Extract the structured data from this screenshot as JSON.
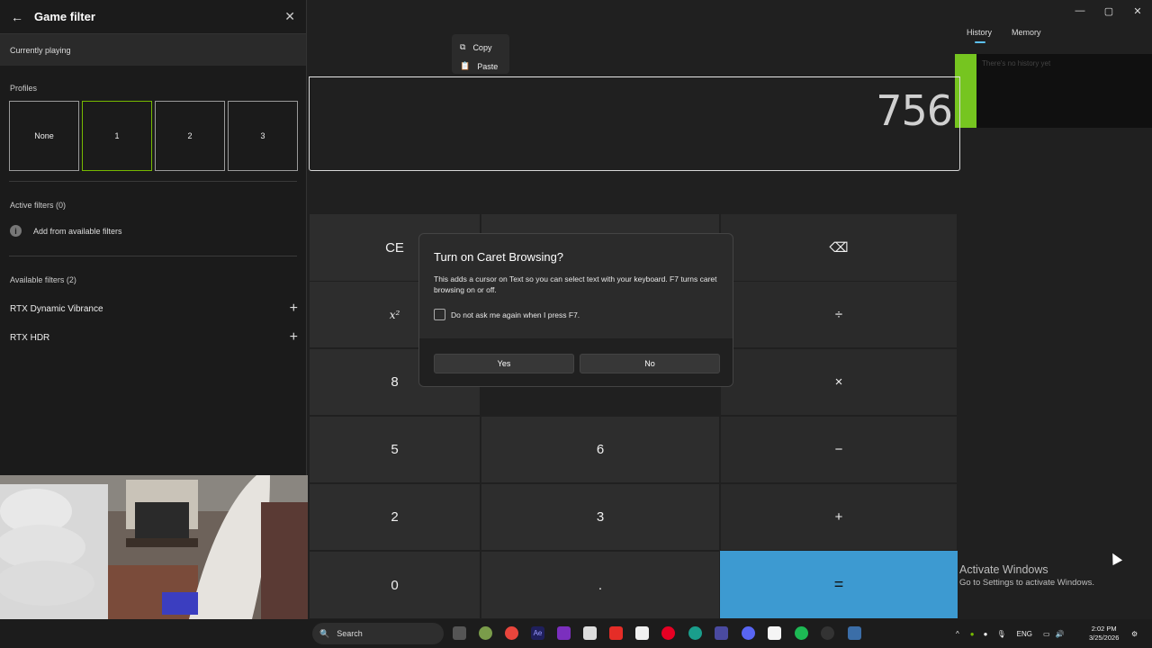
{
  "calculator": {
    "window_controls": [
      "—",
      "▢",
      "✕"
    ],
    "tabs": {
      "history": "History",
      "memory": "Memory"
    },
    "history_empty": "There's no history yet",
    "display_value": "756",
    "context_menu": {
      "copy": "Copy",
      "paste": "Paste"
    },
    "keys": {
      "ce": "CE",
      "backspace": "⌫",
      "square": "x²",
      "divide": "÷",
      "eight": "8",
      "multiply": "×",
      "five": "5",
      "six": "6",
      "minus": "−",
      "two": "2",
      "three": "3",
      "plus": "+",
      "zero": "0",
      "decimal": ".",
      "equals": "="
    },
    "equals_color": "#3d9ad1"
  },
  "game_filter": {
    "title": "Game filter",
    "currently_playing": "Currently playing",
    "profiles_label": "Profiles",
    "profiles": [
      "None",
      "1",
      "2",
      "3"
    ],
    "active_profile_index": 1,
    "active_filters_label": "Active filters (0)",
    "add_filters_label": "Add from available filters",
    "available_filters_label": "Available filters (2)",
    "available_filters": [
      "RTX Dynamic Vibrance",
      "RTX HDR"
    ],
    "accent_color": "#76b900"
  },
  "dialog": {
    "title": "Turn on Caret Browsing?",
    "body": "This adds a cursor on Text so you can select text with your keyboard. F7 turns caret browsing on or off.",
    "checkbox_label": "Do not ask me again when I press F7.",
    "yes": "Yes",
    "no": "No"
  },
  "watermark": {
    "line1": "Activate Windows",
    "line2": "Go to Settings to activate Windows."
  },
  "taskbar": {
    "search_label": "Search",
    "language": "ENG",
    "time": "2:02 PM",
    "date": "3/25/2026"
  }
}
